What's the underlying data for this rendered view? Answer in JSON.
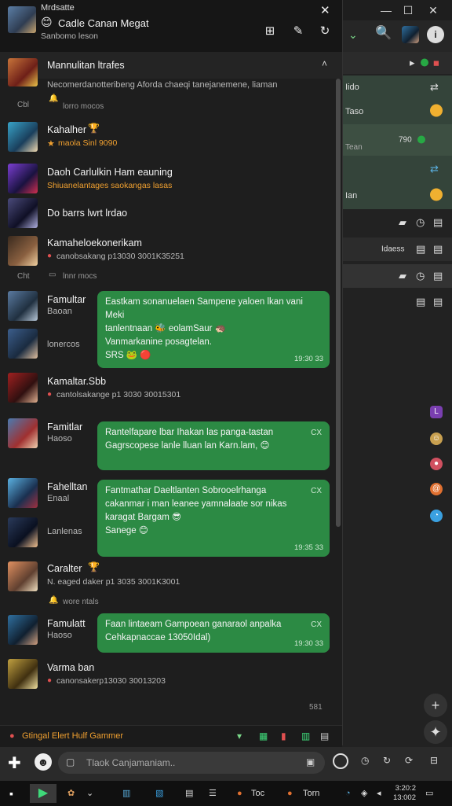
{
  "colors": {
    "accent": "#2c8a44",
    "highlight": "#f0a030",
    "background": "#1e1e1e"
  },
  "header": {
    "top_label": "Mrdsatte",
    "title": "Cadle Canan Megat",
    "subtitle": "Sanbomo leson",
    "title_emoji": "😊"
  },
  "section_header": {
    "label": "Mannulitan ltrafes",
    "chevron": "˄"
  },
  "banner_text": "Necomerdanotteribeng Aforda chaeqi tanejanemene, liaman",
  "pinned": [
    {
      "num": "Cbl",
      "label": "lorro mocos"
    }
  ],
  "contacts": [
    {
      "name": "Kahalher",
      "sub": "maola Sinl 9090"
    },
    {
      "name": "Daoh Carlulkin Ham eauning",
      "sub": "Shiuanelantages saokangas lasas"
    },
    {
      "name": "Do barrs lwrt lrdao",
      "sub": ""
    },
    {
      "name": "Kamaheloekonerikam",
      "sub": "canobsakang p13030 3001K35251"
    },
    {
      "name": "Kamaltar.Sbb",
      "sub": "cantolsakange p1 3030 30015301"
    },
    {
      "name": "Caralter",
      "sub": "N. eaged daker p1 3035 3001K3001"
    },
    {
      "name": "Varma ban",
      "sub": "canonsakerp13030 30013203"
    }
  ],
  "minor_rows": [
    {
      "num": "Cht",
      "label": "lnnr mocs"
    },
    {
      "label": "wore ntals"
    }
  ],
  "bubble_groups": [
    {
      "left_top": "Famultar",
      "left_bottom": "Baoan",
      "second": "lonercos"
    },
    {
      "left_top": "Famitlar",
      "left_bottom": "Haoso"
    },
    {
      "left_top": "Fahelltan",
      "left_bottom": "Enaal",
      "second": "Lanlenas"
    },
    {
      "left_top": "Famulatt",
      "left_bottom": "Haoso"
    }
  ],
  "bubbles": [
    {
      "lines": [
        "Eastkam sonanuelaen Sampene yaloen lkan vani Meki",
        "tanlentnaan 🐝 eolamSaur 🦔",
        "Vanmarkanine posagtelan.",
        "SRS 🐸 🔴"
      ],
      "time": "19:30 33"
    },
    {
      "lines": [
        "Rantelfapare lbar Ihakan las panga-tastan",
        "Gagrscopese lanle lluan lan Karn.lam, 😊"
      ],
      "time": "",
      "corner": "CX"
    },
    {
      "lines": [
        "Fantmathar Daeltlanten Sobrooelrhanga",
        "cakanmar i man leanee yamnalaate sor nikas",
        "karagat Bargam 😎",
        "Sanege 😊"
      ],
      "time": "19:35 33",
      "corner": "CX"
    },
    {
      "lines": [
        "Faan lintaeam Gampoean ganaraol anpalka",
        "Cehkapnaccae 13050Idal)"
      ],
      "time": "19:30 33",
      "corner": "CX"
    }
  ],
  "bottom_count": "581",
  "status_text": "Gtingal Elert Hulf Gammer",
  "input_placeholder": "Tlaok Canjamaniam..",
  "bg_app": {
    "rows": [
      {
        "label": "Iido"
      },
      {
        "label": "Taso"
      },
      {
        "label": "Tean",
        "value": "790"
      },
      {
        "label": "Ian"
      },
      {
        "label": "Idaess"
      }
    ]
  },
  "taskbar": {
    "items": [
      "Toc",
      "Torn"
    ],
    "clock_time": "3:20:2",
    "clock_date": "13:002"
  },
  "icons": [
    "close-icon",
    "minimize-icon",
    "maximize-icon",
    "search-icon",
    "info-icon",
    "attach-icon",
    "mic-icon",
    "refresh-icon",
    "plus-icon",
    "emoji-icon",
    "send-icon",
    "chevron-up-icon"
  ]
}
